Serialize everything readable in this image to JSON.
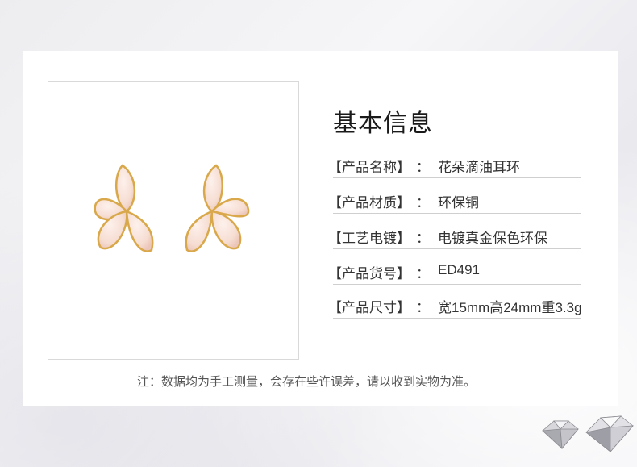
{
  "section_title": "基本信息",
  "specs": [
    {
      "label": "【产品名称】",
      "colon": "：",
      "value": "花朵滴油耳环"
    },
    {
      "label": "【产品材质】",
      "colon": "：",
      "value": "环保铜"
    },
    {
      "label": "【工艺电镀】",
      "colon": "：",
      "value": "电镀真金保色环保"
    },
    {
      "label": "【产品货号】",
      "colon": "：",
      "value": "ED491"
    },
    {
      "label": "【产品尺寸】",
      "colon": "：",
      "value": "宽15mm高24mm重3.3g"
    }
  ],
  "note": "注：数据均为手工测量，会存在些许误差，请以收到实物为准。",
  "colors": {
    "petal": "#f6ddd2",
    "gold": "#d9a84a",
    "text": "#333333"
  }
}
